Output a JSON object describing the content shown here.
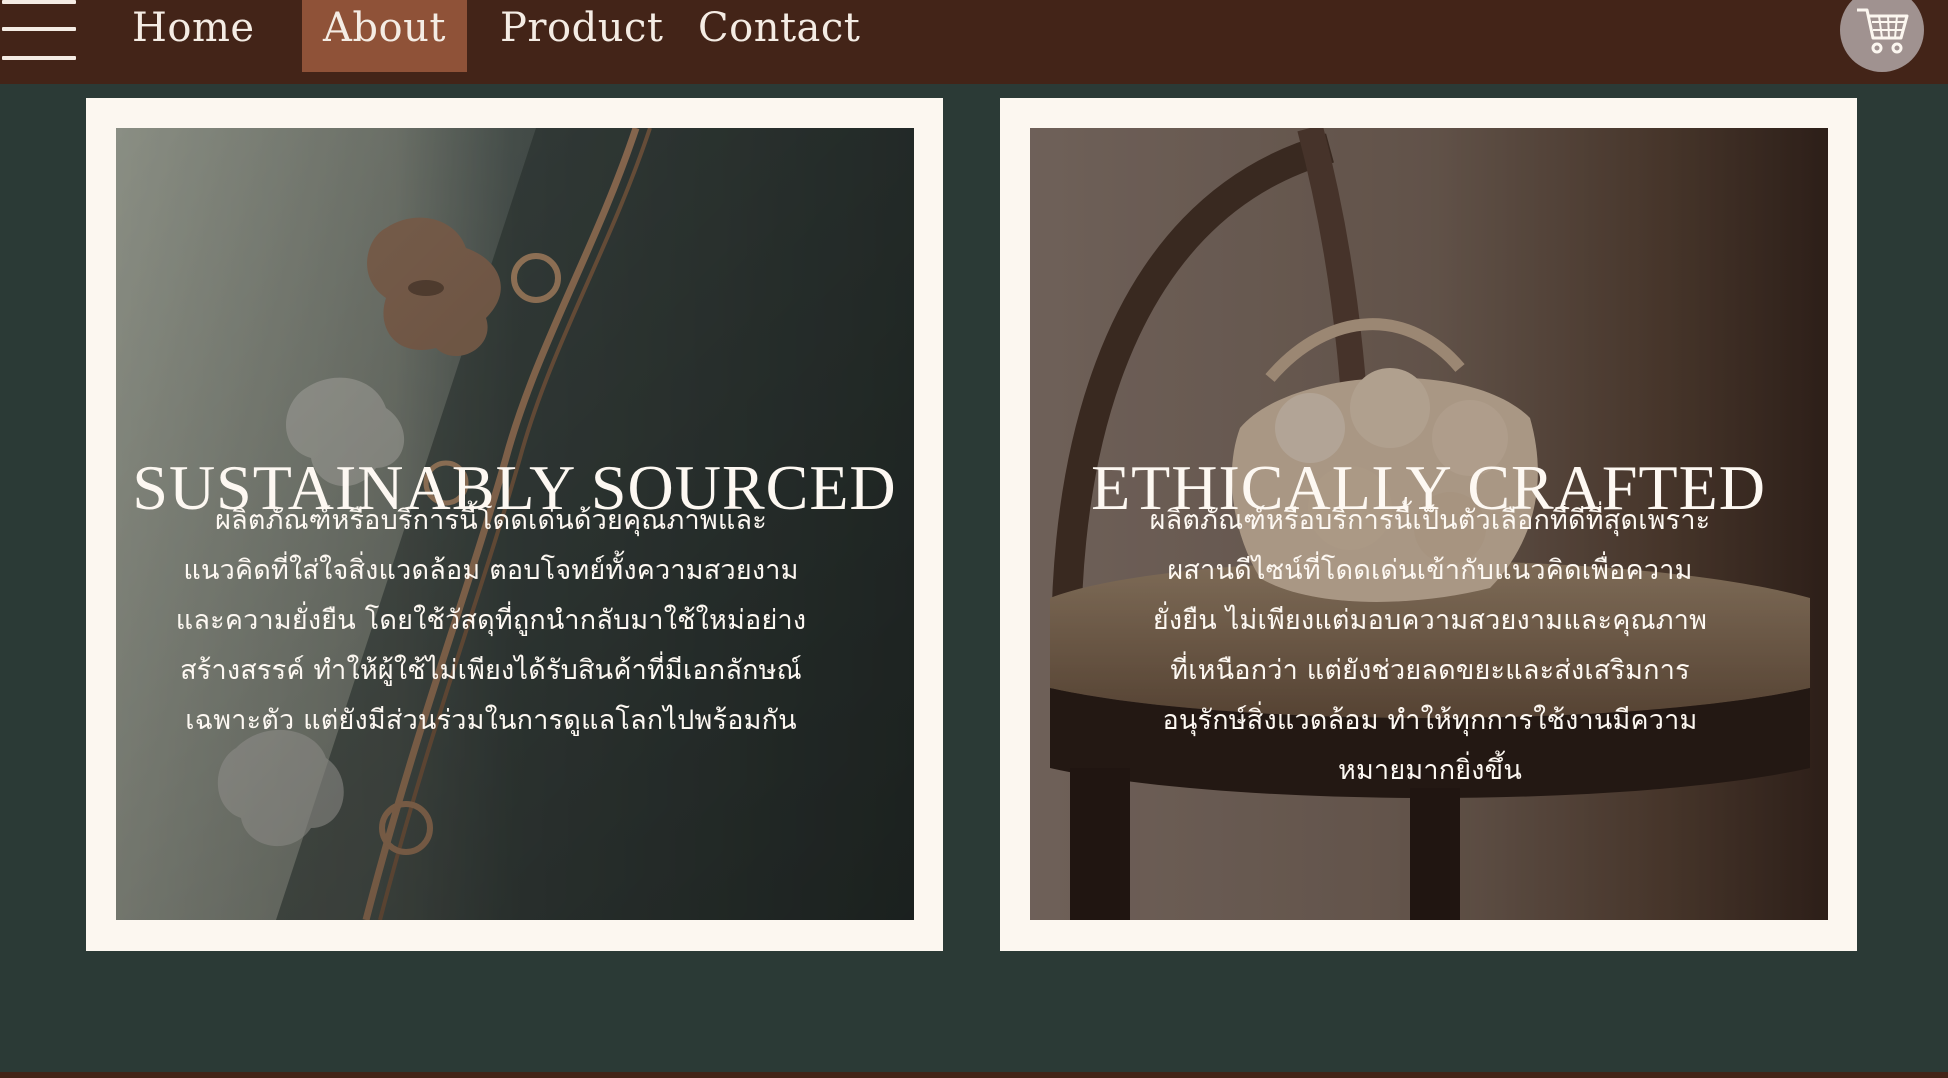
{
  "nav": {
    "items": [
      {
        "label": "Home"
      },
      {
        "label": "About",
        "active": true
      },
      {
        "label": "Product"
      },
      {
        "label": "Contact"
      }
    ],
    "menu_icon": "hamburger-menu-icon",
    "cart_icon": "shopping-cart-icon"
  },
  "cards": [
    {
      "title": "SUSTAINABLY SOURCED",
      "body": "ผลิตภัณฑ์หรือบริการนี้โดดเด่นด้วยคุณภาพและ\nแนวคิดที่ใส่ใจสิ่งแวดล้อม ตอบโจทย์ทั้งความสวยงาม\nและความยั่งยืน โดยใช้วัสดุที่ถูกนำกลับมาใช้ใหม่อย่าง\nสร้างสรรค์ ทำให้ผู้ใช้ไม่เพียงได้รับสินค้าที่มีเอกลักษณ์\nเฉพาะตัว แต่ยังมีส่วนร่วมในการดูแลโลกไปพร้อมกัน"
    },
    {
      "title": "ETHICALLY CRAFTED",
      "body": "ผลิตภัณฑ์หรือบริการนี้เป็นตัวเลือกที่ดีที่สุดเพราะ\nผสานดีไซน์ที่โดดเด่นเข้ากับแนวคิดเพื่อความ\nยั่งยืน ไม่เพียงแต่มอบความสวยงามและคุณภาพ\nที่เหนือกว่า แต่ยังช่วยลดขยะและส่งเสริมการ\nอนุรักษ์สิ่งแวดล้อม ทำให้ทุกการใช้งานมีความ\nหมายมากยิ่งขึ้น"
    }
  ],
  "colors": {
    "topbar": "#432418",
    "active_tab": "#8f5238",
    "page_background": "#2b3a36",
    "card_frame": "#fcf7f0",
    "text_light": "#fdf8f2"
  }
}
